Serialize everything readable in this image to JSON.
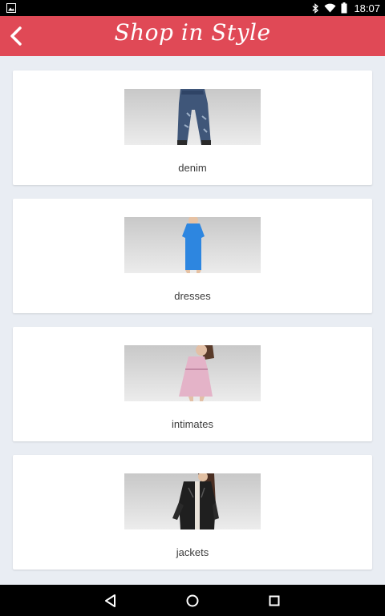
{
  "status_bar": {
    "time": "18:07",
    "icons": [
      "image-notification-icon",
      "bluetooth-icon",
      "wifi-icon",
      "battery-icon"
    ]
  },
  "app_bar": {
    "title": "Shop in Style",
    "background": "#e04956",
    "back_icon": "chevron-left-icon"
  },
  "categories": [
    {
      "label": "denim",
      "image": "jeans-photo"
    },
    {
      "label": "dresses",
      "image": "blue-dress-photo"
    },
    {
      "label": "intimates",
      "image": "pink-babydoll-photo"
    },
    {
      "label": "jackets",
      "image": "leather-jacket-photo"
    }
  ],
  "nav_bar": {
    "icons": [
      "back-triangle-icon",
      "home-circle-icon",
      "recents-square-icon"
    ]
  }
}
